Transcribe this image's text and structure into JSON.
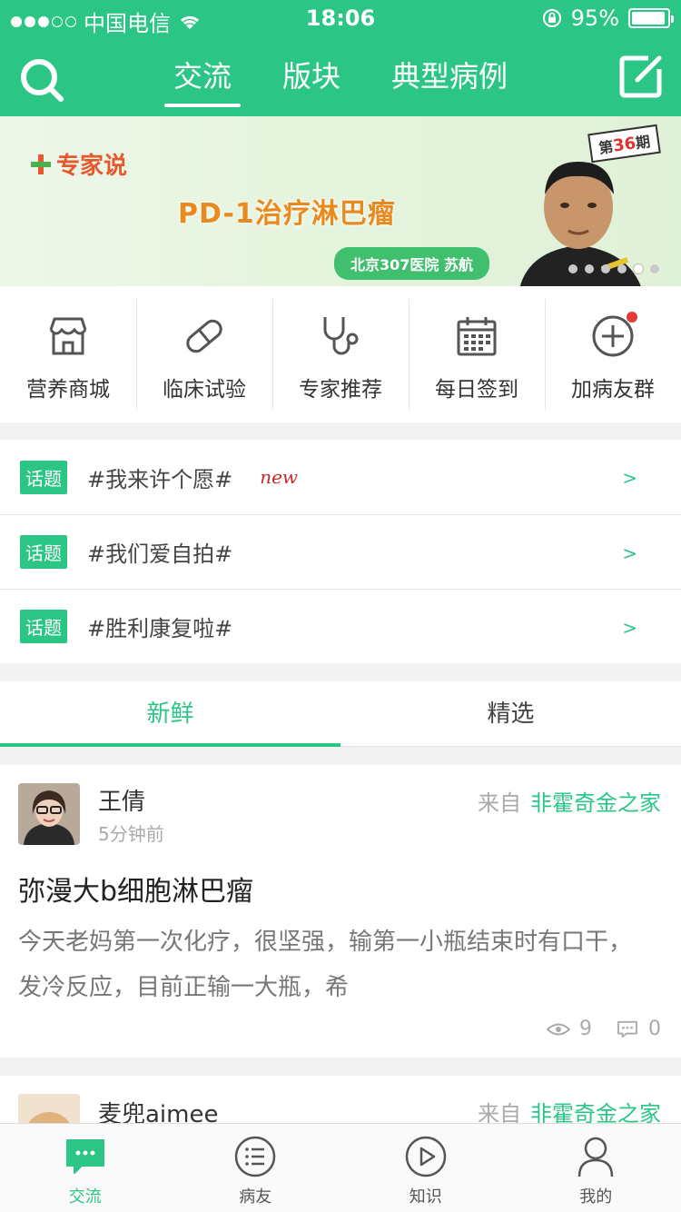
{
  "status_bar": {
    "carrier": "中国电信",
    "time": "18:06",
    "battery_text": "95%"
  },
  "header": {
    "tabs": [
      {
        "label": "交流",
        "active": true
      },
      {
        "label": "版块",
        "active": false
      },
      {
        "label": "典型病例",
        "active": false
      }
    ],
    "search_icon": "search-icon",
    "compose_icon": "compose-icon"
  },
  "banner": {
    "brand": "专家说",
    "headline": "PD-1治疗淋巴瘤",
    "hospital": "北京307医院 苏航",
    "issue_prefix": "第",
    "issue_number": "36",
    "issue_suffix": "期",
    "pages": 6,
    "active_page": 5
  },
  "quick_actions": [
    {
      "label": "营养商城",
      "icon": "shop-icon"
    },
    {
      "label": "临床试验",
      "icon": "pill-icon"
    },
    {
      "label": "专家推荐",
      "icon": "stethoscope-icon"
    },
    {
      "label": "每日签到",
      "icon": "calendar-icon"
    },
    {
      "label": "加病友群",
      "icon": "add-circle-icon"
    }
  ],
  "topics": [
    {
      "badge": "话题",
      "title": "#我来许个愿#",
      "new": "new",
      "arrow": ">"
    },
    {
      "badge": "话题",
      "title": "#我们爱自拍#",
      "new": "",
      "arrow": ">"
    },
    {
      "badge": "话题",
      "title": "#胜利康复啦#",
      "new": "",
      "arrow": ">"
    }
  ],
  "feed_tabs": [
    {
      "label": "新鲜",
      "active": true
    },
    {
      "label": "精选",
      "active": false
    }
  ],
  "posts": [
    {
      "name": "王倩",
      "time": "5分钟前",
      "from_label": "来自",
      "from_source": "非霍奇金之家",
      "title": "弥漫大b细胞淋巴瘤",
      "body": "今天老妈第一次化疗，很坚强，输第一小瓶结束时有口干，发冷反应，目前正输一大瓶，希",
      "views": "9",
      "comments": "0"
    },
    {
      "name": "麦兜aimee",
      "from_label": "来自",
      "from_source": "非霍奇金之家"
    }
  ],
  "bottom_nav": [
    {
      "label": "交流",
      "icon": "chat-icon",
      "active": true
    },
    {
      "label": "病友",
      "icon": "list-icon",
      "active": false
    },
    {
      "label": "知识",
      "icon": "play-icon",
      "active": false
    },
    {
      "label": "我的",
      "icon": "user-icon",
      "active": false
    }
  ],
  "colors": {
    "brand_green": "#2bc585",
    "badge_red": "#e53935"
  }
}
